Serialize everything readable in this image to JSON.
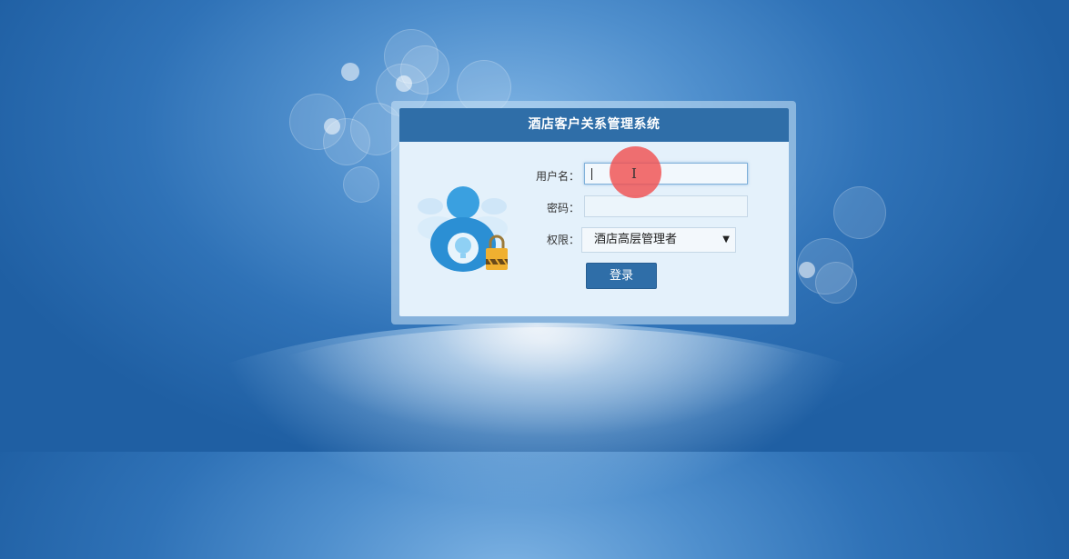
{
  "window": {
    "title": "酒店客户关系管理系统"
  },
  "form": {
    "username_label": "用户名：",
    "username_value": "",
    "password_label": "密码：",
    "password_value": "",
    "role_label": "权限：",
    "role_selected": "酒店高层管理者",
    "login_button": "登录"
  },
  "icons": {
    "user": "user-lock-icon",
    "select_arrow": "dropdown-arrow-icon",
    "cursor": "text-cursor-icon"
  },
  "colors": {
    "header": "#2f6ea8",
    "button": "#2f6ea8",
    "panel_bg": "#e4f1fb",
    "cursor_highlight": "#f05050"
  }
}
